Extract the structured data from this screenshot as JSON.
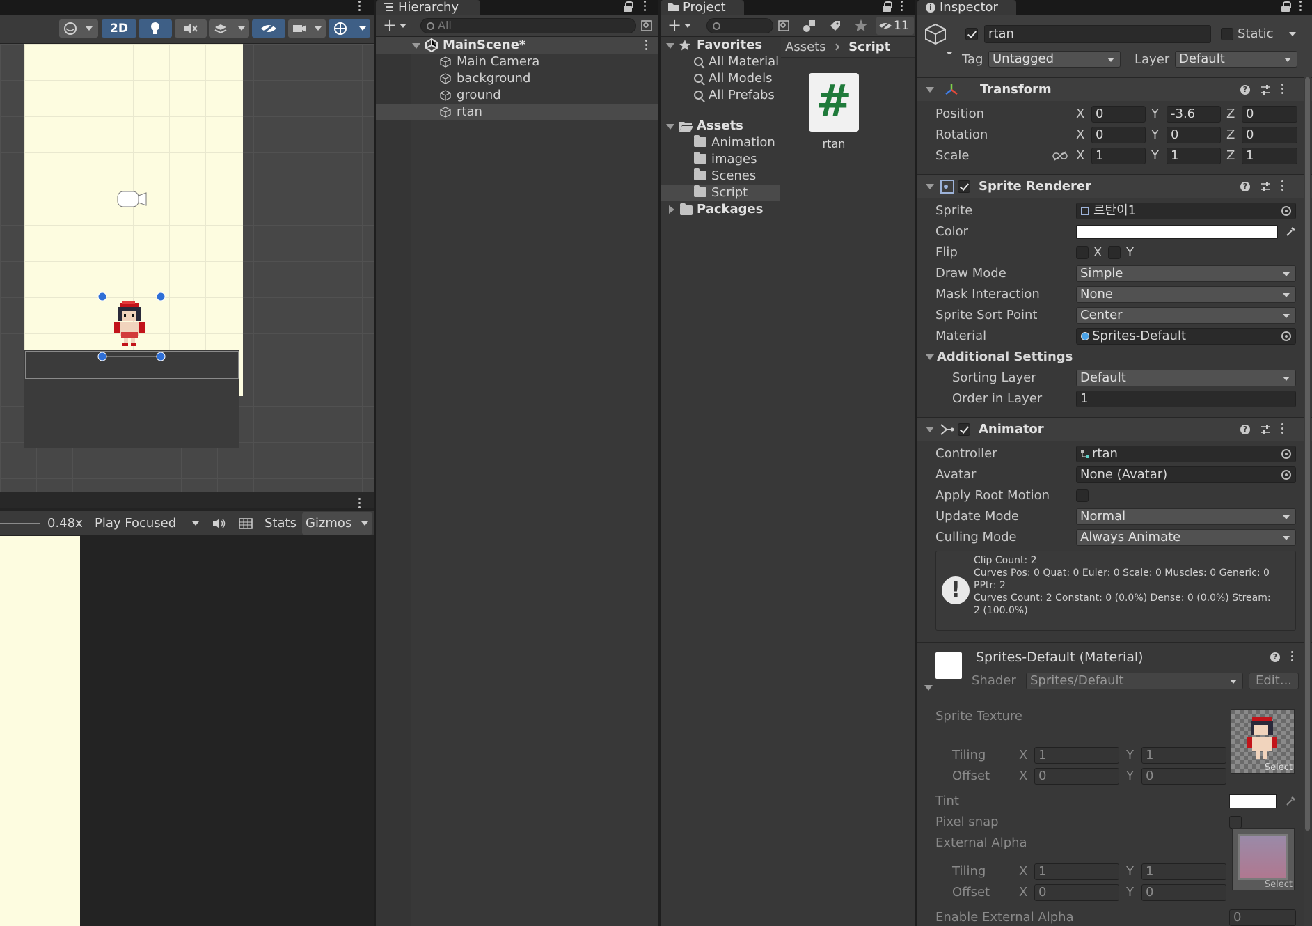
{
  "scene": {
    "btn_2d": "2D"
  },
  "game": {
    "zoom": "0.48x",
    "play_mode": "Play Focused",
    "stats": "Stats",
    "gizmos": "Gizmos"
  },
  "hierarchy": {
    "tab": "Hierarchy",
    "search_placeholder": "All",
    "scene": "MainScene*",
    "items": [
      "Main Camera",
      "background",
      "ground",
      "rtan"
    ]
  },
  "project": {
    "tab": "Project",
    "hidden_count": "11",
    "favorites": "Favorites",
    "favorite_items": [
      "All Material",
      "All Models",
      "All Prefabs"
    ],
    "assets": "Assets",
    "asset_folders": [
      "Animation",
      "images",
      "Scenes",
      "Script"
    ],
    "packages": "Packages",
    "breadcrumb": [
      "Assets",
      "Script"
    ],
    "file_name": "rtan",
    "file_icon": "#"
  },
  "inspector": {
    "tab": "Inspector",
    "object_name": "rtan",
    "static_label": "Static",
    "tag_label": "Tag",
    "tag_value": "Untagged",
    "layer_label": "Layer",
    "layer_value": "Default",
    "transform": {
      "title": "Transform",
      "position": {
        "label": "Position",
        "x": "0",
        "y": "-3.6",
        "z": "0"
      },
      "rotation": {
        "label": "Rotation",
        "x": "0",
        "y": "0",
        "z": "0"
      },
      "scale": {
        "label": "Scale",
        "x": "1",
        "y": "1",
        "z": "1"
      },
      "axis_x": "X",
      "axis_y": "Y",
      "axis_z": "Z"
    },
    "sprite_renderer": {
      "title": "Sprite Renderer",
      "sprite_label": "Sprite",
      "sprite_value": "르탄이1",
      "color_label": "Color",
      "flip_label": "Flip",
      "flip_x": "X",
      "flip_y": "Y",
      "draw_mode_label": "Draw Mode",
      "draw_mode": "Simple",
      "mask_label": "Mask Interaction",
      "mask": "None",
      "sort_point_label": "Sprite Sort Point",
      "sort_point": "Center",
      "material_label": "Material",
      "material": "Sprites-Default",
      "additional": "Additional Settings",
      "sorting_layer_label": "Sorting Layer",
      "sorting_layer": "Default",
      "order_label": "Order in Layer",
      "order": "1"
    },
    "animator": {
      "title": "Animator",
      "controller_label": "Controller",
      "controller": "rtan",
      "avatar_label": "Avatar",
      "avatar": "None (Avatar)",
      "root_motion_label": "Apply Root Motion",
      "update_mode_label": "Update Mode",
      "update_mode": "Normal",
      "culling_label": "Culling Mode",
      "culling": "Always Animate",
      "info": [
        "Clip Count: 2",
        "Curves Pos: 0 Quat: 0 Euler: 0 Scale: 0 Muscles: 0 Generic: 0",
        "PPtr: 2",
        "Curves Count: 2 Constant: 0 (0.0%) Dense: 0 (0.0%) Stream:",
        "2 (100.0%)"
      ]
    },
    "material": {
      "title": "Sprites-Default (Material)",
      "shader_label": "Shader",
      "shader": "Sprites/Default",
      "edit": "Edit...",
      "sprite_texture": "Sprite Texture",
      "tiling": "Tiling",
      "offset": "Offset",
      "tiling_x": "1",
      "tiling_y": "1",
      "offset_x": "0",
      "offset_y": "0",
      "select": "Select",
      "tint": "Tint",
      "pixel_snap": "Pixel snap",
      "external_alpha": "External Alpha",
      "tiling2_x": "1",
      "tiling2_y": "1",
      "offset2_x": "0",
      "offset2_y": "0",
      "enable_external_alpha": "Enable External Alpha",
      "enable_external_alpha_value": "0"
    }
  },
  "colors": {
    "scene_bg": "#fdfce0",
    "panel": "#383838",
    "accent": "#2c5d87",
    "handle": "#2f6fd6"
  }
}
